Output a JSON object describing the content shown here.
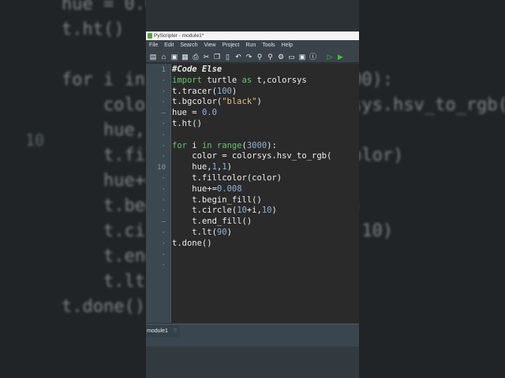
{
  "window": {
    "title": "PyScripter - module1*"
  },
  "menu": [
    "File",
    "Edit",
    "Search",
    "View",
    "Project",
    "Run",
    "Tools",
    "Help"
  ],
  "toolbar": [
    {
      "name": "new-file-icon",
      "glyph": "▤"
    },
    {
      "name": "open-icon",
      "glyph": "⌂"
    },
    {
      "name": "save-icon",
      "glyph": "▣"
    },
    {
      "name": "save-all-icon",
      "glyph": "▦"
    },
    {
      "name": "print-icon",
      "glyph": "⎙"
    },
    {
      "name": "cut-icon",
      "glyph": "✂"
    },
    {
      "name": "copy-icon",
      "glyph": "❐"
    },
    {
      "name": "paste-icon",
      "glyph": "▯"
    },
    {
      "name": "undo-icon",
      "glyph": "↶"
    },
    {
      "name": "redo-icon",
      "glyph": "↷"
    },
    {
      "name": "search-icon",
      "glyph": "⚲"
    },
    {
      "name": "find-next-icon",
      "glyph": "⚲"
    },
    {
      "name": "replace-icon",
      "glyph": "⚙"
    },
    {
      "name": "folder-icon",
      "glyph": "▭"
    },
    {
      "name": "window-icon",
      "glyph": "▣"
    },
    {
      "name": "info-icon",
      "glyph": "ⓘ"
    },
    {
      "name": "run-icon",
      "glyph": "▷"
    },
    {
      "name": "debug-icon",
      "glyph": "▶"
    }
  ],
  "accent": {
    "run": "#3fc23f"
  },
  "gutter": {
    "1": "1",
    "10": "10"
  },
  "code": [
    [
      [
        "#Code Else",
        "cm"
      ]
    ],
    [
      [
        "import",
        "kw"
      ],
      [
        " turtle ",
        ""
      ],
      [
        "as",
        "kw"
      ],
      [
        " t,colorsys",
        ""
      ]
    ],
    [
      [
        "t.tracer(",
        ""
      ],
      [
        "100",
        "num"
      ],
      [
        ")",
        ""
      ]
    ],
    [
      [
        "t.bgcolor(",
        ""
      ],
      [
        "\"black\"",
        "str"
      ],
      [
        ")",
        ""
      ]
    ],
    [
      [
        "hue = ",
        ""
      ],
      [
        "0.0",
        "num"
      ]
    ],
    [
      [
        "t.ht()",
        ""
      ]
    ],
    [
      [
        "",
        ""
      ]
    ],
    [
      [
        "for",
        "kw"
      ],
      [
        " i ",
        ""
      ],
      [
        "in",
        "kw"
      ],
      [
        " ",
        ""
      ],
      [
        "range",
        "fn"
      ],
      [
        "(",
        ""
      ],
      [
        "3000",
        "num"
      ],
      [
        "):",
        ""
      ]
    ],
    [
      [
        "    color = colorsys.hsv_to_rgb(",
        ""
      ]
    ],
    [
      [
        "    hue,",
        ""
      ],
      [
        "1",
        "num"
      ],
      [
        ",",
        ""
      ],
      [
        "1",
        "num"
      ],
      [
        ")",
        ""
      ]
    ],
    [
      [
        "    t.fillcolor(color)",
        ""
      ]
    ],
    [
      [
        "    hue+=",
        ""
      ],
      [
        "0.008",
        "num"
      ]
    ],
    [
      [
        "    t.begin_fill()",
        ""
      ]
    ],
    [
      [
        "    t.circle(",
        ""
      ],
      [
        "10",
        "num"
      ],
      [
        "+i,",
        ""
      ],
      [
        "10",
        "num"
      ],
      [
        ")",
        ""
      ]
    ],
    [
      [
        "    t.end_fill()",
        ""
      ]
    ],
    [
      [
        "    t.lt(",
        ""
      ],
      [
        "90",
        "num"
      ],
      [
        ")",
        ""
      ]
    ],
    [
      [
        "t.done()",
        ""
      ]
    ]
  ],
  "tabs": [
    {
      "label": "module1"
    }
  ]
}
